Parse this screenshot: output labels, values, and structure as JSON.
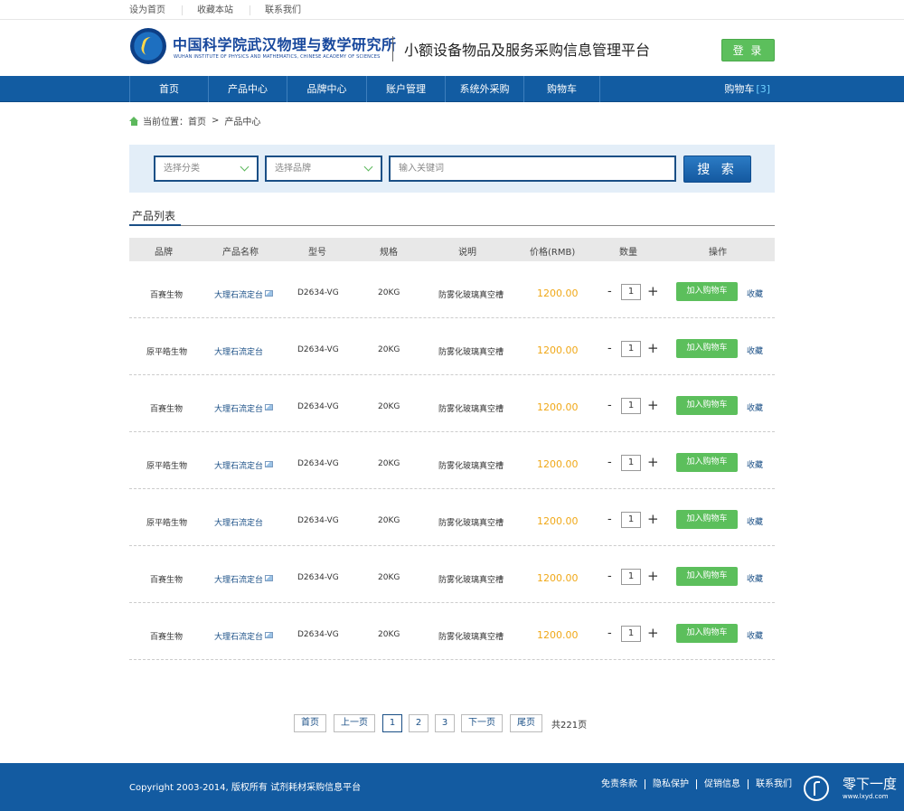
{
  "topbar": {
    "links": [
      "设为首页",
      "收藏本站",
      "联系我们"
    ]
  },
  "header": {
    "institute_cn": "中国科学院武汉物理与数学研究所",
    "institute_en": "WUHAN INSTITUTE OF PHYSICS AND MATHEMATICS, CHINESE ACADEMY OF SCIENCES",
    "platform_title": "小额设备物品及服务采购信息管理平台",
    "login_label": "登 录"
  },
  "nav": {
    "items": [
      "首页",
      "产品中心",
      "品牌中心",
      "账户管理",
      "系统外采购",
      "购物车"
    ],
    "cart_label": "购物车",
    "cart_count": "[3]"
  },
  "breadcrumb": {
    "prefix": "当前位置：",
    "home": "首页",
    "separator": ">",
    "current": "产品中心"
  },
  "search": {
    "category_placeholder": "选择分类",
    "brand_placeholder": "选择品牌",
    "keyword_placeholder": "输入关键词",
    "button_label": "搜 索"
  },
  "list": {
    "tab_label": "产品列表",
    "columns": [
      "品牌",
      "产品名称",
      "型号",
      "规格",
      "说明",
      "价格(RMB)",
      "数量",
      "操作"
    ],
    "rows": [
      {
        "brand": "百赛生物",
        "name": "大理石流定台",
        "has_image": true,
        "model": "D2634-VG",
        "spec": "20KG",
        "desc": "防雾化玻璃真空槽",
        "price": "1200.00",
        "qty": "1",
        "add": "加入购物车",
        "fav": "收藏"
      },
      {
        "brand": "原平皓生物",
        "name": "大理石流定台",
        "has_image": false,
        "model": "D2634-VG",
        "spec": "20KG",
        "desc": "防雾化玻璃真空槽",
        "price": "1200.00",
        "qty": "1",
        "add": "加入购物车",
        "fav": "收藏"
      },
      {
        "brand": "百赛生物",
        "name": "大理石流定台",
        "has_image": true,
        "model": "D2634-VG",
        "spec": "20KG",
        "desc": "防雾化玻璃真空槽",
        "price": "1200.00",
        "qty": "1",
        "add": "加入购物车",
        "fav": "收藏"
      },
      {
        "brand": "原平皓生物",
        "name": "大理石流定台",
        "has_image": true,
        "model": "D2634-VG",
        "spec": "20KG",
        "desc": "防雾化玻璃真空槽",
        "price": "1200.00",
        "qty": "1",
        "add": "加入购物车",
        "fav": "收藏"
      },
      {
        "brand": "原平皓生物",
        "name": "大理石流定台",
        "has_image": false,
        "model": "D2634-VG",
        "spec": "20KG",
        "desc": "防雾化玻璃真空槽",
        "price": "1200.00",
        "qty": "1",
        "add": "加入购物车",
        "fav": "收藏"
      },
      {
        "brand": "百赛生物",
        "name": "大理石流定台",
        "has_image": true,
        "model": "D2634-VG",
        "spec": "20KG",
        "desc": "防雾化玻璃真空槽",
        "price": "1200.00",
        "qty": "1",
        "add": "加入购物车",
        "fav": "收藏"
      },
      {
        "brand": "百赛生物",
        "name": "大理石流定台",
        "has_image": true,
        "model": "D2634-VG",
        "spec": "20KG",
        "desc": "防雾化玻璃真空槽",
        "price": "1200.00",
        "qty": "1",
        "add": "加入购物车",
        "fav": "收藏"
      }
    ]
  },
  "pagination": {
    "first": "首页",
    "prev": "上一页",
    "pages": [
      "1",
      "2",
      "3"
    ],
    "current": "1",
    "next": "下一页",
    "last": "尾页",
    "total": "共221页"
  },
  "footer": {
    "copyright": "Copyright 2003-2014, 版权所有 试剂耗材采购信息平台",
    "links": [
      "免责条款",
      "隐私保护",
      "促销信息",
      "联系我们"
    ],
    "watermark_text": "零下一度",
    "watermark_url": "www.lxyd.com"
  },
  "colors": {
    "primary": "#125ca2",
    "accent_green": "#5cbf5c",
    "price": "#f0a818",
    "search_bg": "#e3eef8"
  }
}
